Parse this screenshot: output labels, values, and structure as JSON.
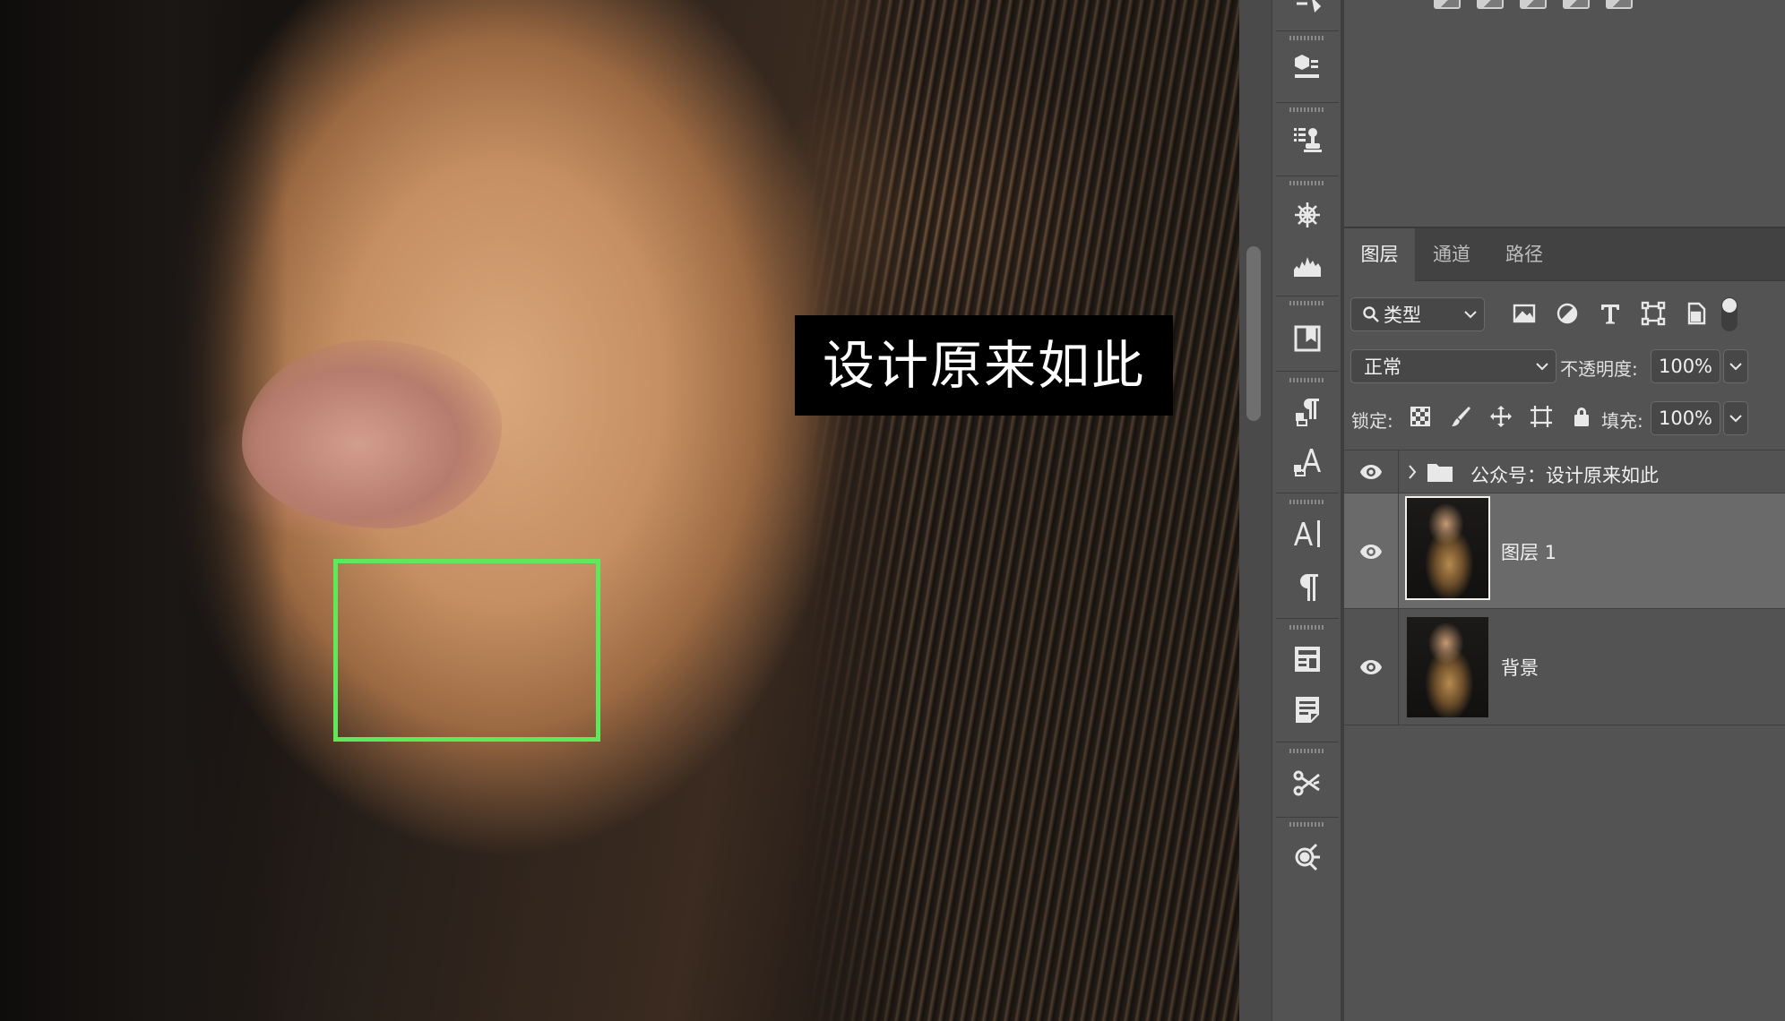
{
  "canvas": {
    "watermark_text": "设计原来如此"
  },
  "layers_panel": {
    "tabs": [
      {
        "label": "图层",
        "active": true
      },
      {
        "label": "通道",
        "active": false
      },
      {
        "label": "路径",
        "active": false
      }
    ],
    "filter": {
      "label": "类型"
    },
    "blend_mode": "正常",
    "opacity": {
      "label": "不透明度:",
      "value": "100%"
    },
    "lock": {
      "label": "锁定:"
    },
    "fill": {
      "label": "填充:",
      "value": "100%"
    },
    "layers": [
      {
        "name": "公众号：设计原来如此",
        "type": "group",
        "visible": true,
        "selected": false
      },
      {
        "name": "图层 1",
        "type": "pixel",
        "visible": true,
        "selected": true
      },
      {
        "name": "背景",
        "type": "pixel",
        "visible": true,
        "selected": false
      }
    ]
  },
  "colors": {
    "panel_bg": "#535353",
    "selection_box": "#5ee85a",
    "selected_layer": "#6a6a6a"
  }
}
